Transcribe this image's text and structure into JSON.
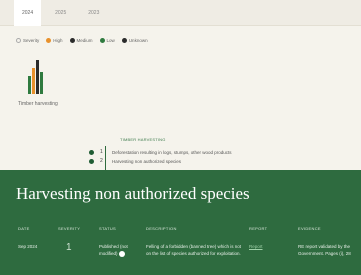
{
  "tabs": [
    {
      "label": "2024",
      "active": true
    },
    {
      "label": "2025",
      "active": false
    },
    {
      "label": "2023",
      "active": false
    }
  ],
  "legend": [
    {
      "label": "Severity",
      "color": "#ffffff",
      "hollow": true
    },
    {
      "label": "High",
      "color": "#e8912c",
      "hollow": false
    },
    {
      "label": "Medium",
      "color": "#2b2b2b",
      "hollow": false
    },
    {
      "label": "Low",
      "color": "#2f7a3f",
      "hollow": false
    },
    {
      "label": "Unknown",
      "color": "#2b2b2b",
      "hollow": false
    }
  ],
  "chart": {
    "label": "Timber harvesting",
    "bar_colors": [
      "#2f7a3f",
      "#e8912c",
      "#2b2b2b",
      "#2f7a3f"
    ]
  },
  "timeline": {
    "heading": "TIMBER HARVESTING",
    "items": [
      {
        "num": "1",
        "text": "Deforestation resulting in logs, stumps, other wood products"
      },
      {
        "num": "2",
        "text": "Harvesting non authorized species"
      }
    ]
  },
  "panel": {
    "title": "Harvesting non authorized species",
    "headers": {
      "date": "DATE",
      "severity": "SEVERITY",
      "status": "STATUS",
      "description": "DESCRIPTION",
      "report": "REPORT",
      "evidence": "EVIDENCE"
    },
    "row": {
      "date": "Sep 2024",
      "severity": "1",
      "status": "Published (not modified)",
      "description": "Felling of a forbidden (banned tree) which is not on the list of species authorized for exploitation.",
      "report": "Report",
      "evidence": "RE report validated by the Government. Pages (i), 28"
    }
  }
}
